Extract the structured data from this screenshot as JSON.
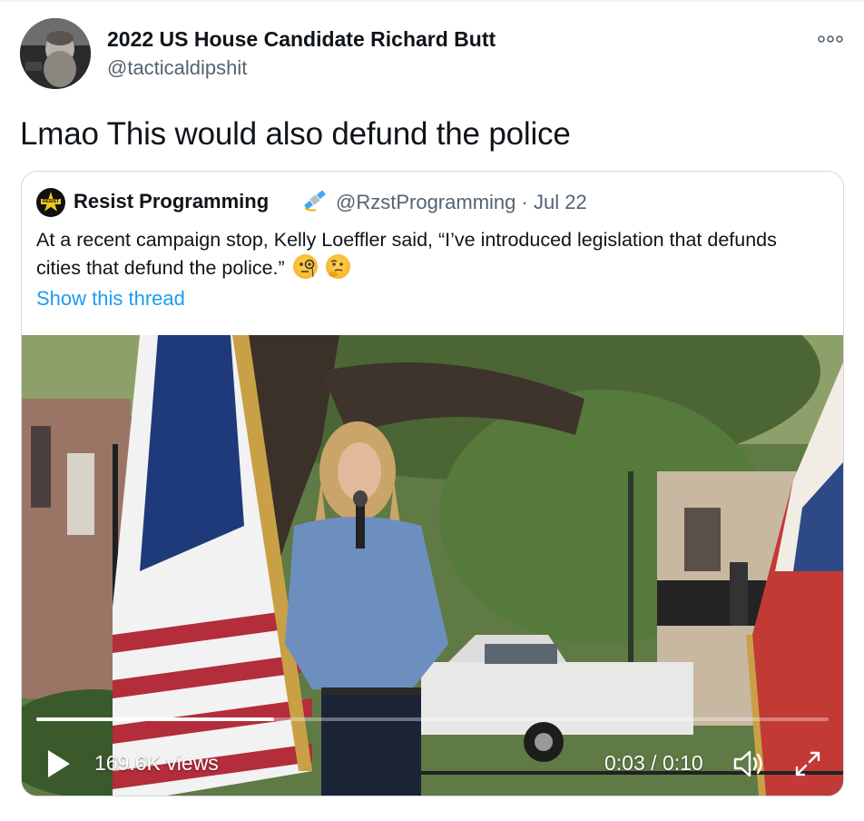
{
  "tweet": {
    "author_name": "2022 US House Candidate Richard Butt",
    "author_handle": "@tacticaldipshit",
    "text": "Lmao This would also defund the police",
    "more_icon": "more-horizontal-icon"
  },
  "quoted": {
    "name": "Resist Programming",
    "name_emoji": "satellite-emoji",
    "handle": "@RzstProgramming",
    "separator": "·",
    "date": "Jul 22",
    "text": "At a recent campaign stop, Kelly Loeffler said, “I’ve introduced legislation that defunds cities that defund the police.”",
    "text_emojis": [
      "face-with-monocle-emoji",
      "thinking-face-emoji"
    ],
    "avatar_badge": "RESIST",
    "show_thread": "Show this thread"
  },
  "video": {
    "views": "169.6K views",
    "current_time": "0:03",
    "time_separator": " / ",
    "duration": "0:10",
    "progress": 0.3,
    "icons": [
      "play-icon",
      "volume-icon",
      "fullscreen-icon"
    ]
  },
  "colors": {
    "link": "#1d9bf0",
    "secondary_text": "#536471",
    "border": "#cfd9de"
  }
}
